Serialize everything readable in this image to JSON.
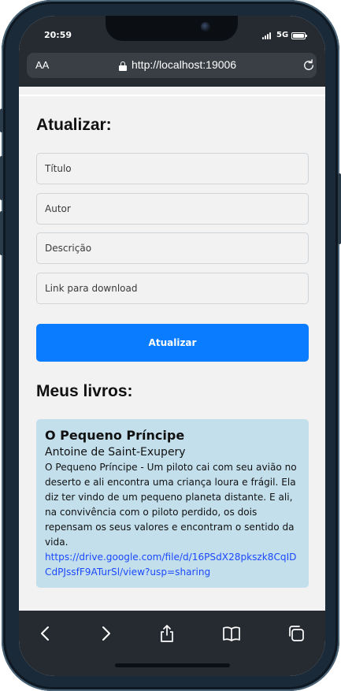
{
  "status_bar": {
    "time": "20:59",
    "network": "5G"
  },
  "browser": {
    "text_size": "AA",
    "url": "http://localhost:19006"
  },
  "update_form": {
    "heading": "Atualizar:",
    "title_placeholder": "Título",
    "author_placeholder": "Autor",
    "description_placeholder": "Descrição",
    "link_placeholder": "Link para download",
    "submit_label": "Atualizar"
  },
  "my_books": {
    "heading": "Meus livros:",
    "books": [
      {
        "title": "O Pequeno Príncipe",
        "author": "Antoine de Saint-Exupery",
        "description": "O Pequeno Príncipe - Um piloto cai com seu avião no deserto e ali encontra uma criança loura e frágil. Ela diz ter vindo de um pequeno planeta distante. E ali, na convivência com o piloto perdido, os dois repensam os seus valores e encontram o sentido da vida.",
        "link": "https://drive.google.com/file/d/16PSdX28pkszk8CqIDCdPJssfF9ATurSl/view?usp=sharing"
      }
    ]
  },
  "toolbar": {
    "icons": [
      "back-icon",
      "forward-icon",
      "share-icon",
      "bookmarks-icon",
      "tabs-icon"
    ]
  },
  "colors": {
    "primary_button": "#0a7cff",
    "card_background": "#c3dfec",
    "link": "#1c49ff",
    "browser_chrome": "#262b31"
  }
}
